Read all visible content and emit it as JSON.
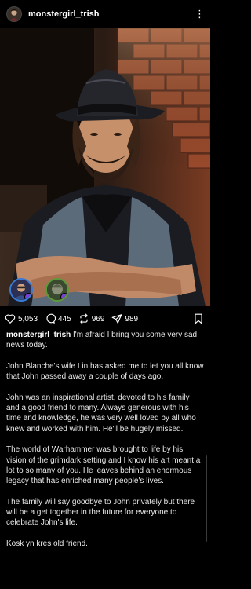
{
  "header": {
    "username": "monstergirl_trish",
    "more_icon": "more-vertical-icon"
  },
  "photo": {
    "alt_icon": "post-photo"
  },
  "tagged": [
    {
      "icon": "tagged-user-avatar"
    },
    {
      "icon": "tagged-user-avatar"
    }
  ],
  "actions": {
    "likes": "5,053",
    "comments": "445",
    "reposts": "969",
    "shares": "989"
  },
  "caption": {
    "author": "monstergirl_trish",
    "intro": " I'm afraid I bring you some very sad news today.",
    "paragraphs": [
      "John Blanche's wife Lin has asked me to let you all know that John passed away a couple of days ago.",
      "John was an inspirational artist, devoted to his family and a good friend to many. Always generous with his time and knowledge, he was very well loved by all who knew and worked with him. He'll be hugely missed.",
      "The world of Warhammer was brought to life by his vision of the grimdark setting and I know his art meant a lot to so many of you. He leaves behind an enormous legacy that has enriched many people's lives.",
      "The family will say goodbye to John privately but there will be a get together in the future for everyone to celebrate John's life.",
      "Kosk yn kres old friend."
    ]
  },
  "colors": {
    "background": "#000000",
    "text": "#e9e9e9",
    "tag_ring_1": "#3a7bd5",
    "tag_ring_2": "#5a9a3a",
    "badge": "#7a3fd6"
  }
}
